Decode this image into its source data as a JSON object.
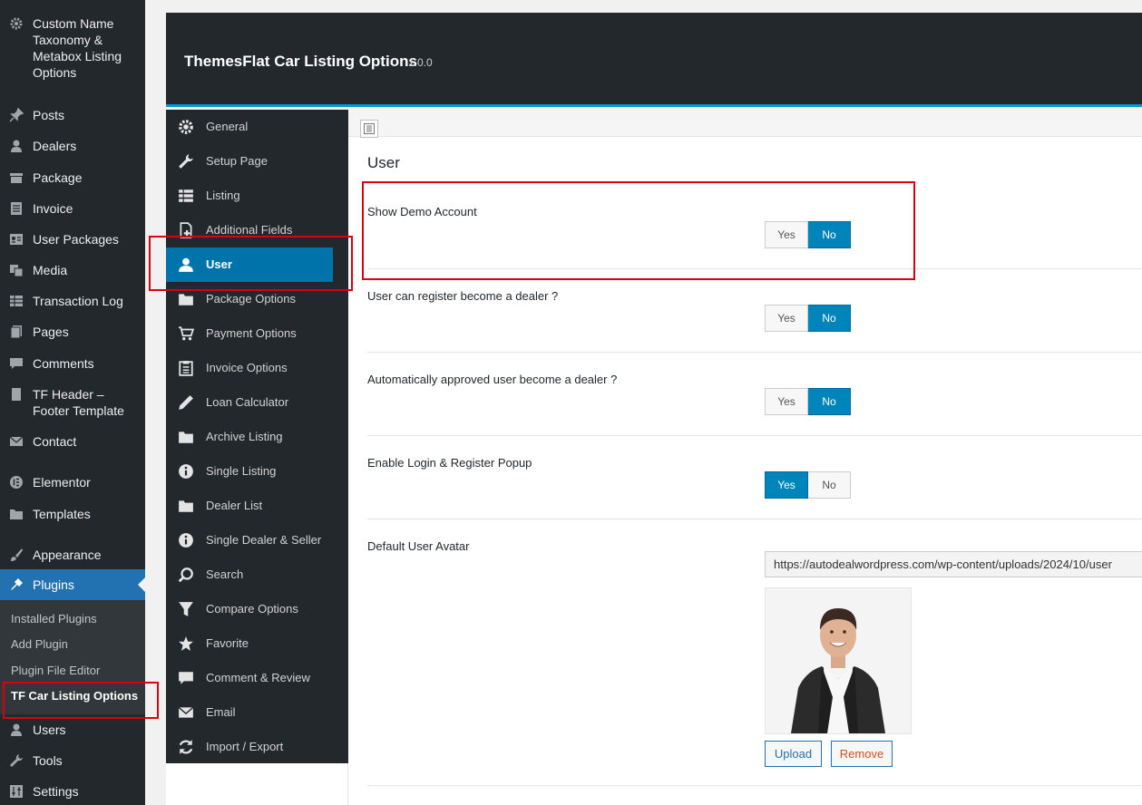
{
  "wp_menu": {
    "items": [
      {
        "label": "Custom Name Taxonomy & Metabox Listing Options",
        "icon": "gear-icon"
      },
      {
        "label": "Posts",
        "icon": "pin-icon"
      },
      {
        "label": "Dealers",
        "icon": "user-icon"
      },
      {
        "label": "Package",
        "icon": "box-icon"
      },
      {
        "label": "Invoice",
        "icon": "document-icon"
      },
      {
        "label": "User Packages",
        "icon": "id-card-icon"
      },
      {
        "label": "Media",
        "icon": "media-icon"
      },
      {
        "label": "Transaction Log",
        "icon": "table-icon"
      },
      {
        "label": "Pages",
        "icon": "pages-icon"
      },
      {
        "label": "Comments",
        "icon": "comment-icon"
      },
      {
        "label": "TF Header – Footer Template",
        "icon": "page-icon"
      },
      {
        "label": "Contact",
        "icon": "mail-icon"
      },
      {
        "label": "Elementor",
        "icon": "elementor-icon"
      },
      {
        "label": "Templates",
        "icon": "folder-icon"
      },
      {
        "label": "Appearance",
        "icon": "brush-icon"
      },
      {
        "label": "Plugins",
        "icon": "plug-icon"
      },
      {
        "label": "Users",
        "icon": "user-icon"
      },
      {
        "label": "Tools",
        "icon": "wrench-icon"
      },
      {
        "label": "Settings",
        "icon": "sliders-icon"
      }
    ],
    "plugins_submenu": [
      "Installed Plugins",
      "Add Plugin",
      "Plugin File Editor",
      "TF Car Listing Options"
    ]
  },
  "header": {
    "title": "ThemesFlat Car Listing Options",
    "version": "1.0.0"
  },
  "plugin_nav": [
    {
      "label": "General",
      "icon": "gear-icon"
    },
    {
      "label": "Setup Page",
      "icon": "wrench-icon"
    },
    {
      "label": "Listing",
      "icon": "list-icon"
    },
    {
      "label": "Additional Fields",
      "icon": "add-file-icon"
    },
    {
      "label": "User",
      "icon": "user-icon"
    },
    {
      "label": "Package Options",
      "icon": "folder-icon"
    },
    {
      "label": "Payment Options",
      "icon": "cart-icon"
    },
    {
      "label": "Invoice Options",
      "icon": "clipboard-icon"
    },
    {
      "label": "Loan Calculator",
      "icon": "pencil-icon"
    },
    {
      "label": "Archive Listing",
      "icon": "folder-icon"
    },
    {
      "label": "Single Listing",
      "icon": "info-icon"
    },
    {
      "label": "Dealer List",
      "icon": "folder-icon"
    },
    {
      "label": "Single Dealer & Seller",
      "icon": "info-icon"
    },
    {
      "label": "Search",
      "icon": "search-icon"
    },
    {
      "label": "Compare Options",
      "icon": "filter-icon"
    },
    {
      "label": "Favorite",
      "icon": "star-icon"
    },
    {
      "label": "Comment & Review",
      "icon": "comment-icon"
    },
    {
      "label": "Email",
      "icon": "mail-icon"
    },
    {
      "label": "Import / Export",
      "icon": "refresh-icon"
    }
  ],
  "section": {
    "title": "User",
    "options": [
      {
        "label": "Show Demo Account",
        "yes": "Yes",
        "no": "No",
        "value": "No"
      },
      {
        "label": "User can register become a dealer ?",
        "yes": "Yes",
        "no": "No",
        "value": "No"
      },
      {
        "label": "Automatically approved user become a dealer ?",
        "yes": "Yes",
        "no": "No",
        "value": "No"
      },
      {
        "label": "Enable Login & Register Popup",
        "yes": "Yes",
        "no": "No",
        "value": "Yes"
      }
    ],
    "avatar": {
      "label": "Default User Avatar",
      "url": "https://autodealwordpress.com/wp-content/uploads/2024/10/user",
      "upload_label": "Upload",
      "remove_label": "Remove"
    }
  },
  "colors": {
    "accent": "#0073aa",
    "highlight_box": "#d9000f",
    "sidebar_bg": "#23282d"
  }
}
